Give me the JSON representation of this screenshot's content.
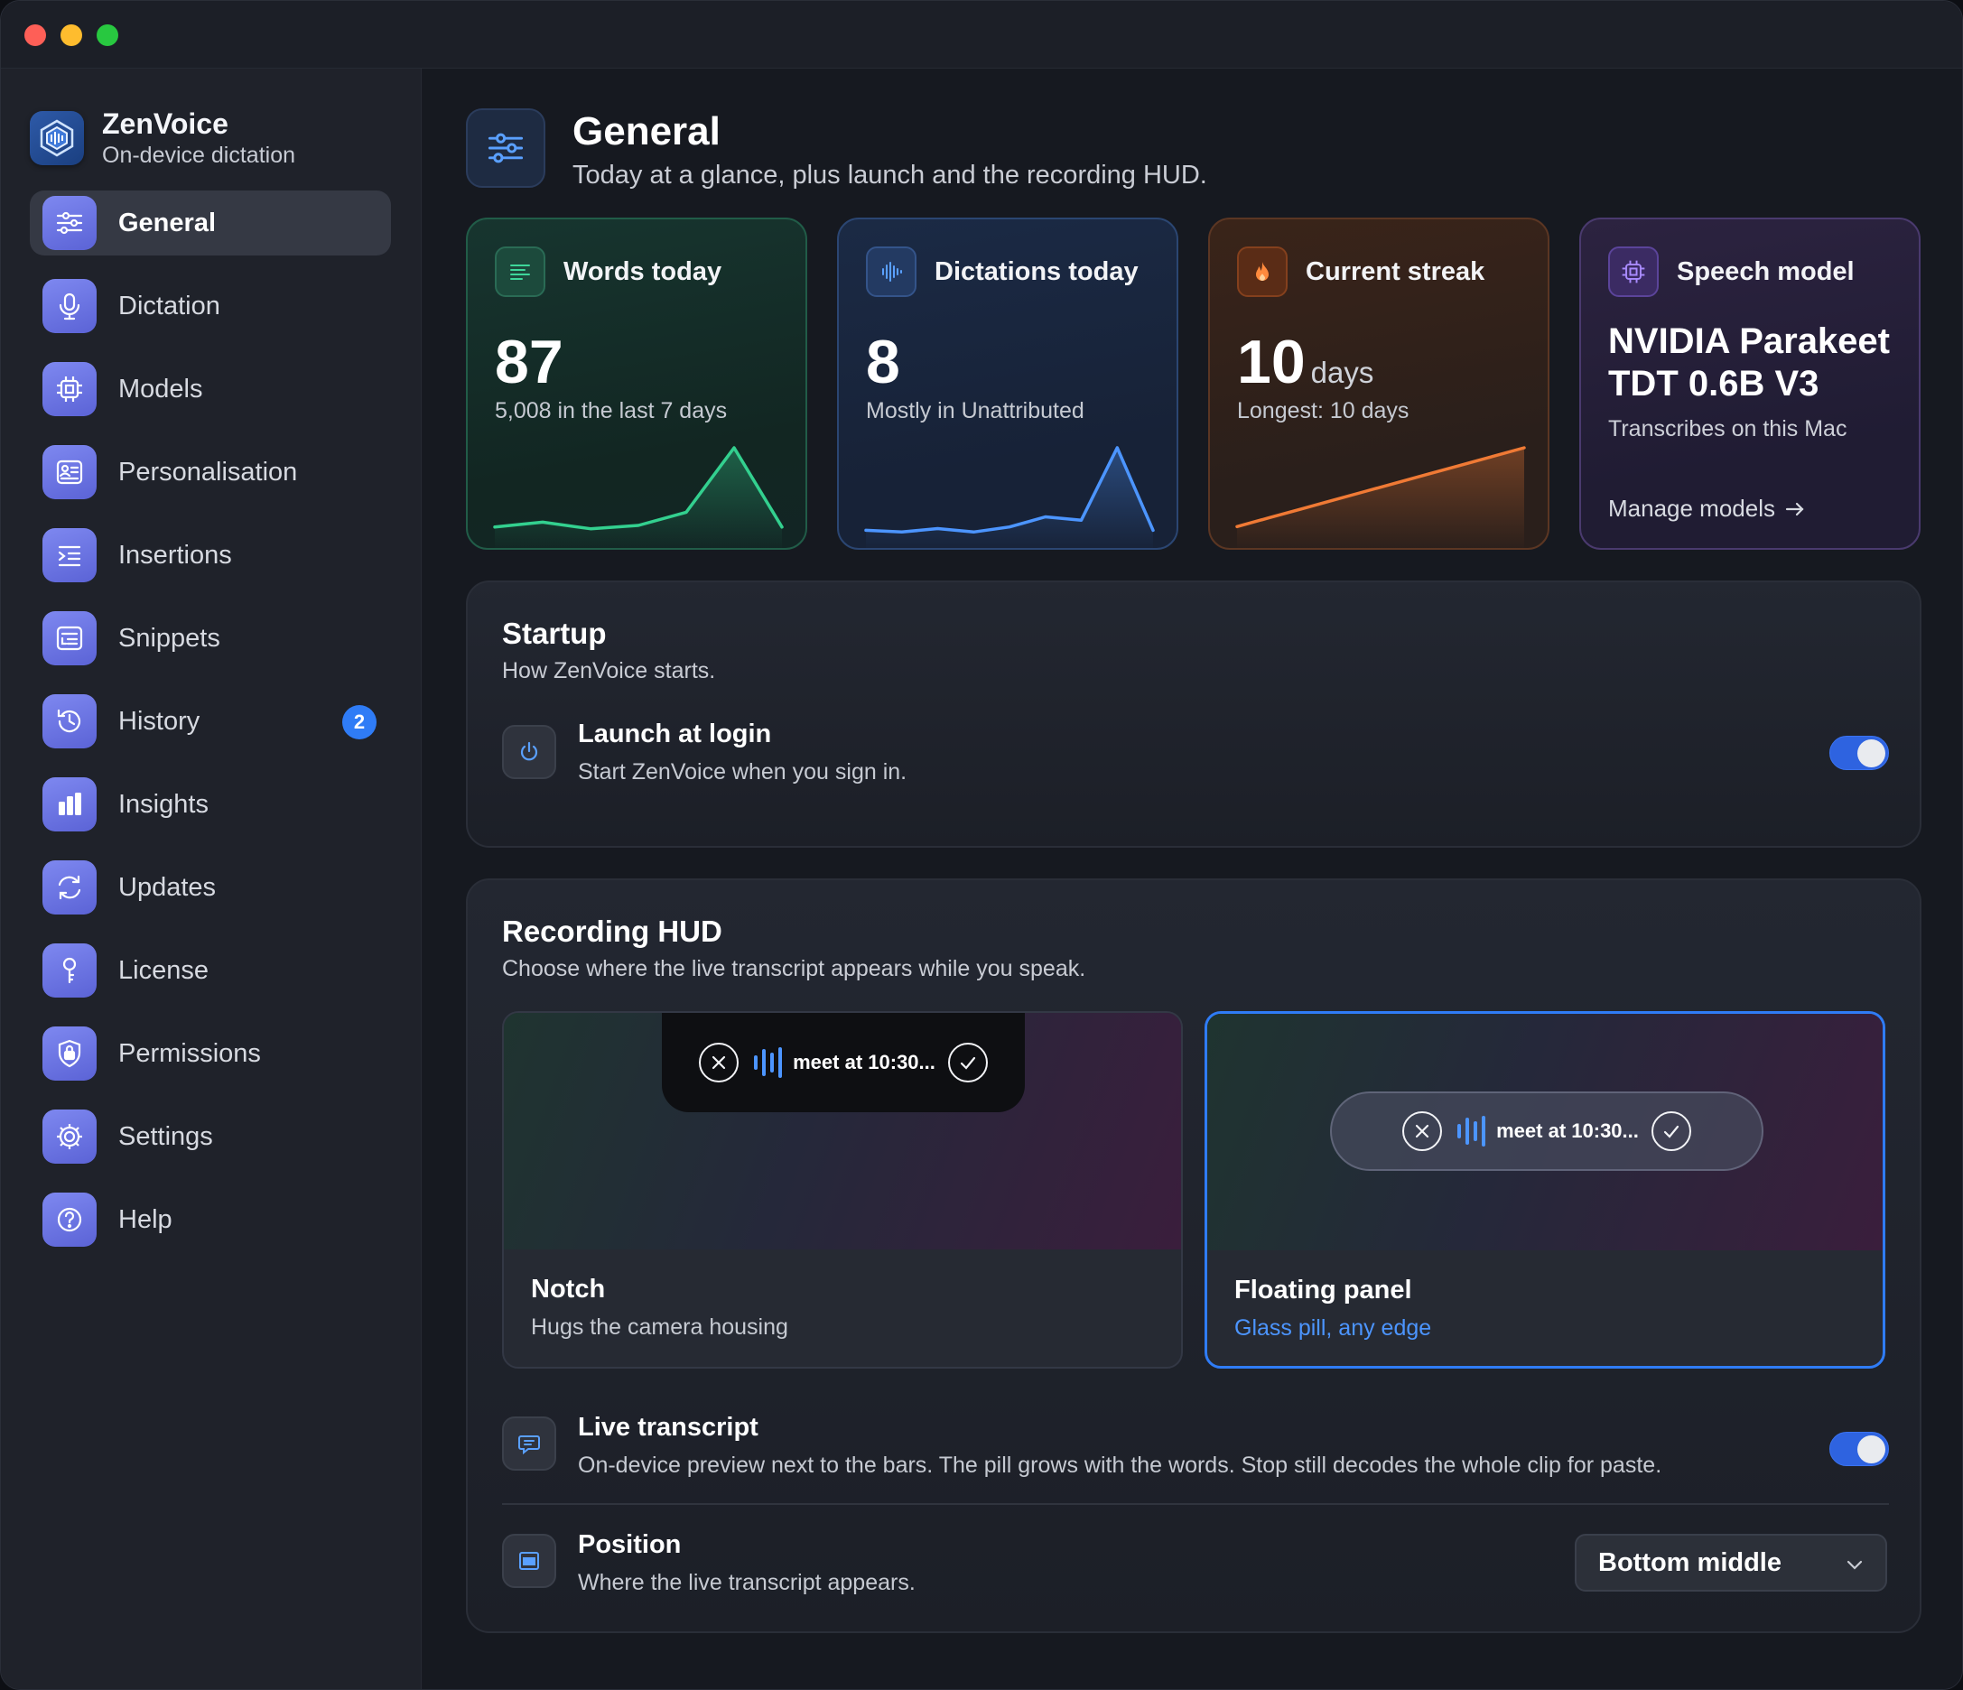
{
  "app": {
    "name": "ZenVoice",
    "tagline": "On-device dictation"
  },
  "sidebar": {
    "items": [
      {
        "label": "General",
        "icon": "sliders-icon",
        "active": true
      },
      {
        "label": "Dictation",
        "icon": "microphone-icon"
      },
      {
        "label": "Models",
        "icon": "chip-icon"
      },
      {
        "label": "Personalisation",
        "icon": "profile-card-icon"
      },
      {
        "label": "Insertions",
        "icon": "text-insert-icon"
      },
      {
        "label": "Snippets",
        "icon": "snippets-icon"
      },
      {
        "label": "History",
        "icon": "history-icon",
        "badge": "2"
      },
      {
        "label": "Insights",
        "icon": "bar-chart-icon"
      },
      {
        "label": "Updates",
        "icon": "refresh-icon"
      },
      {
        "label": "License",
        "icon": "key-icon"
      },
      {
        "label": "Permissions",
        "icon": "shield-lock-icon"
      },
      {
        "label": "Settings",
        "icon": "gear-icon"
      },
      {
        "label": "Help",
        "icon": "question-icon"
      }
    ]
  },
  "header": {
    "title": "General",
    "subtitle": "Today at a glance, plus launch and the recording HUD."
  },
  "stats": {
    "words": {
      "title": "Words today",
      "value": "87",
      "sub": "5,008 in the last 7 days",
      "color": "#33d08f",
      "trend": [
        5,
        8,
        4,
        6,
        14,
        53,
        5
      ]
    },
    "dictations": {
      "title": "Dictations today",
      "value": "8",
      "sub": "Mostly in Unattributed",
      "color": "#4c95ff",
      "trend": [
        3,
        2,
        4,
        2,
        5,
        11,
        9,
        52,
        3
      ]
    },
    "streak": {
      "title": "Current streak",
      "value": "10",
      "unit": "days",
      "sub": "Longest: 10 days",
      "color": "#f07a35",
      "trend": [
        1,
        2,
        3,
        4,
        5,
        6,
        7,
        8,
        9,
        10
      ]
    },
    "model": {
      "title": "Speech model",
      "name": "NVIDIA Parakeet TDT 0.6B V3",
      "sub": "Transcribes on this Mac",
      "link": "Manage models"
    }
  },
  "startup": {
    "title": "Startup",
    "subtitle": "How ZenVoice starts.",
    "launch": {
      "title": "Launch at login",
      "sub": "Start ZenVoice when you sign in.",
      "enabled": true
    }
  },
  "hud": {
    "title": "Recording HUD",
    "subtitle": "Choose where the live transcript appears while you speak.",
    "preview_text": "meet at 10:30...",
    "options": [
      {
        "title": "Notch",
        "sub": "Hugs the camera housing",
        "selected": false
      },
      {
        "title": "Floating panel",
        "sub": "Glass pill, any edge",
        "selected": true
      }
    ],
    "live_transcript": {
      "title": "Live transcript",
      "sub": "On-device preview next to the bars. The pill grows with the words. Stop still decodes the whole clip for paste.",
      "enabled": true
    },
    "position": {
      "title": "Position",
      "sub": "Where the live transcript appears.",
      "value": "Bottom middle"
    }
  }
}
